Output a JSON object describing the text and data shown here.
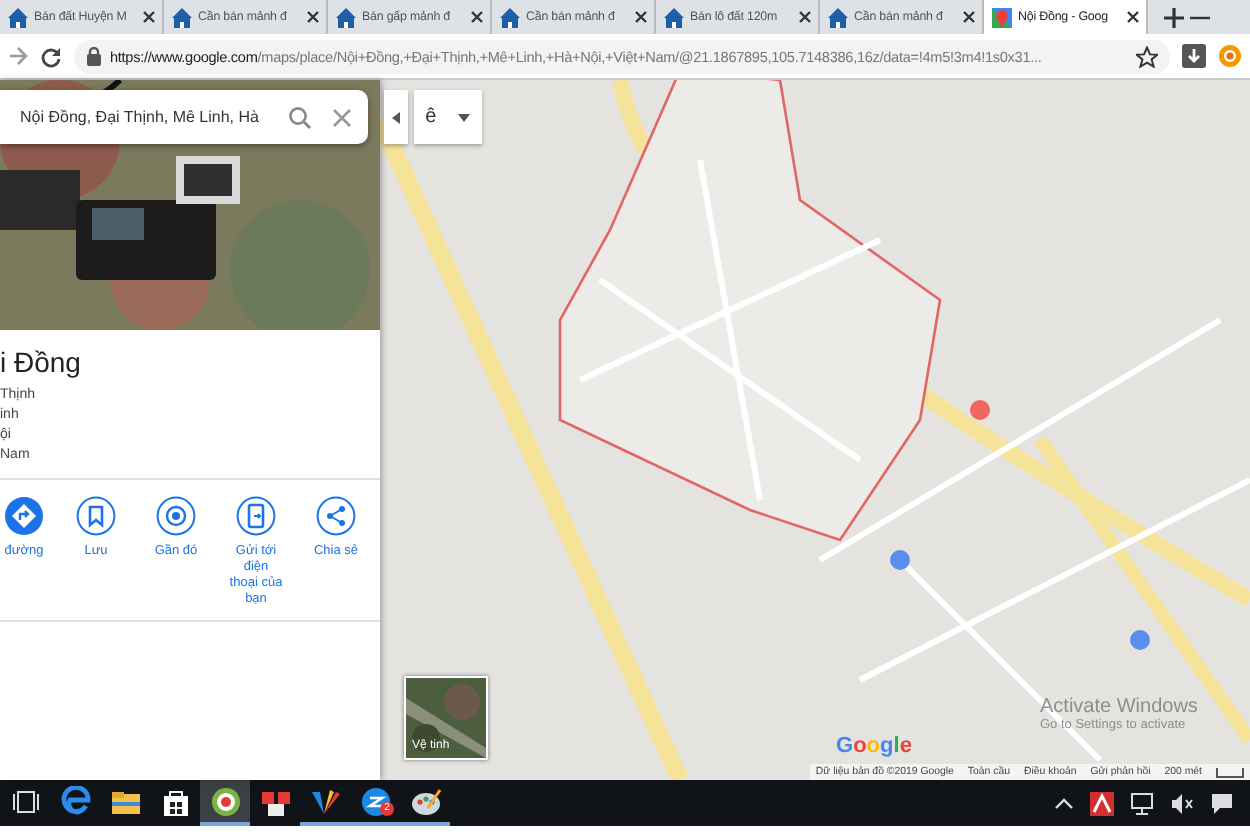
{
  "browser": {
    "tabs": [
      {
        "title": "Bán đất Huyện M",
        "kind": "site",
        "selected": false
      },
      {
        "title": "Cần bán mảnh đ",
        "kind": "site",
        "selected": false
      },
      {
        "title": "Bán gấp mảnh đ",
        "kind": "site",
        "selected": false
      },
      {
        "title": "Cần bán mảnh đ",
        "kind": "site",
        "selected": false
      },
      {
        "title": "Bán lô đất 120m",
        "kind": "site",
        "selected": false
      },
      {
        "title": "Cần bán mảnh đ",
        "kind": "site",
        "selected": false
      },
      {
        "title": "Nội Đồng - Goog",
        "kind": "maps",
        "selected": true
      }
    ],
    "url_host": "https://www.google.com",
    "url_path": "/maps/place/Nội+Đồng,+Đại+Thịnh,+Mê+Linh,+Hà+Nội,+Việt+Nam/@21.1867895,105.7148386,16z/data=!4m5!3m4!1s0x31..."
  },
  "place_panel": {
    "search_value": "Nội Đồng, Đại Thịnh, Mê Linh, Hà",
    "title": "i Đồng",
    "address_lines": [
      "Thịnh",
      "inh",
      "ội",
      "Nam"
    ],
    "actions": [
      {
        "label": "đường",
        "kind": "directions"
      },
      {
        "label": "Lưu",
        "kind": "save"
      },
      {
        "label": "Gần đó",
        "kind": "nearby"
      },
      {
        "label": "Gửi tới điện thoại của bạn",
        "kind": "send"
      },
      {
        "label": "Chia sẻ",
        "kind": "share"
      }
    ]
  },
  "map": {
    "language_button": "ê",
    "layer_switch": "Vệ tinh",
    "logo": "Google",
    "activation": [
      "Activate Windows",
      "Go to Settings to activate"
    ],
    "attribution": [
      "Dữ liệu bản đồ ©2019 Google",
      "Toàn cầu",
      "Điều khoản",
      "Gửi phản hồi"
    ],
    "scale": "200 mét"
  },
  "taskbar": {
    "apps": [
      {
        "kind": "taskview",
        "running": false,
        "selected": false
      },
      {
        "kind": "edge",
        "running": false,
        "selected": false
      },
      {
        "kind": "explorer",
        "running": false,
        "selected": false
      },
      {
        "kind": "store",
        "running": false,
        "selected": false
      },
      {
        "kind": "target",
        "running": true,
        "selected": true
      },
      {
        "kind": "cards",
        "running": false,
        "selected": false
      },
      {
        "kind": "wings",
        "running": true,
        "selected": false
      },
      {
        "kind": "chat",
        "running": true,
        "selected": false,
        "badge": "2"
      },
      {
        "kind": "palette",
        "running": true,
        "selected": false
      }
    ]
  }
}
